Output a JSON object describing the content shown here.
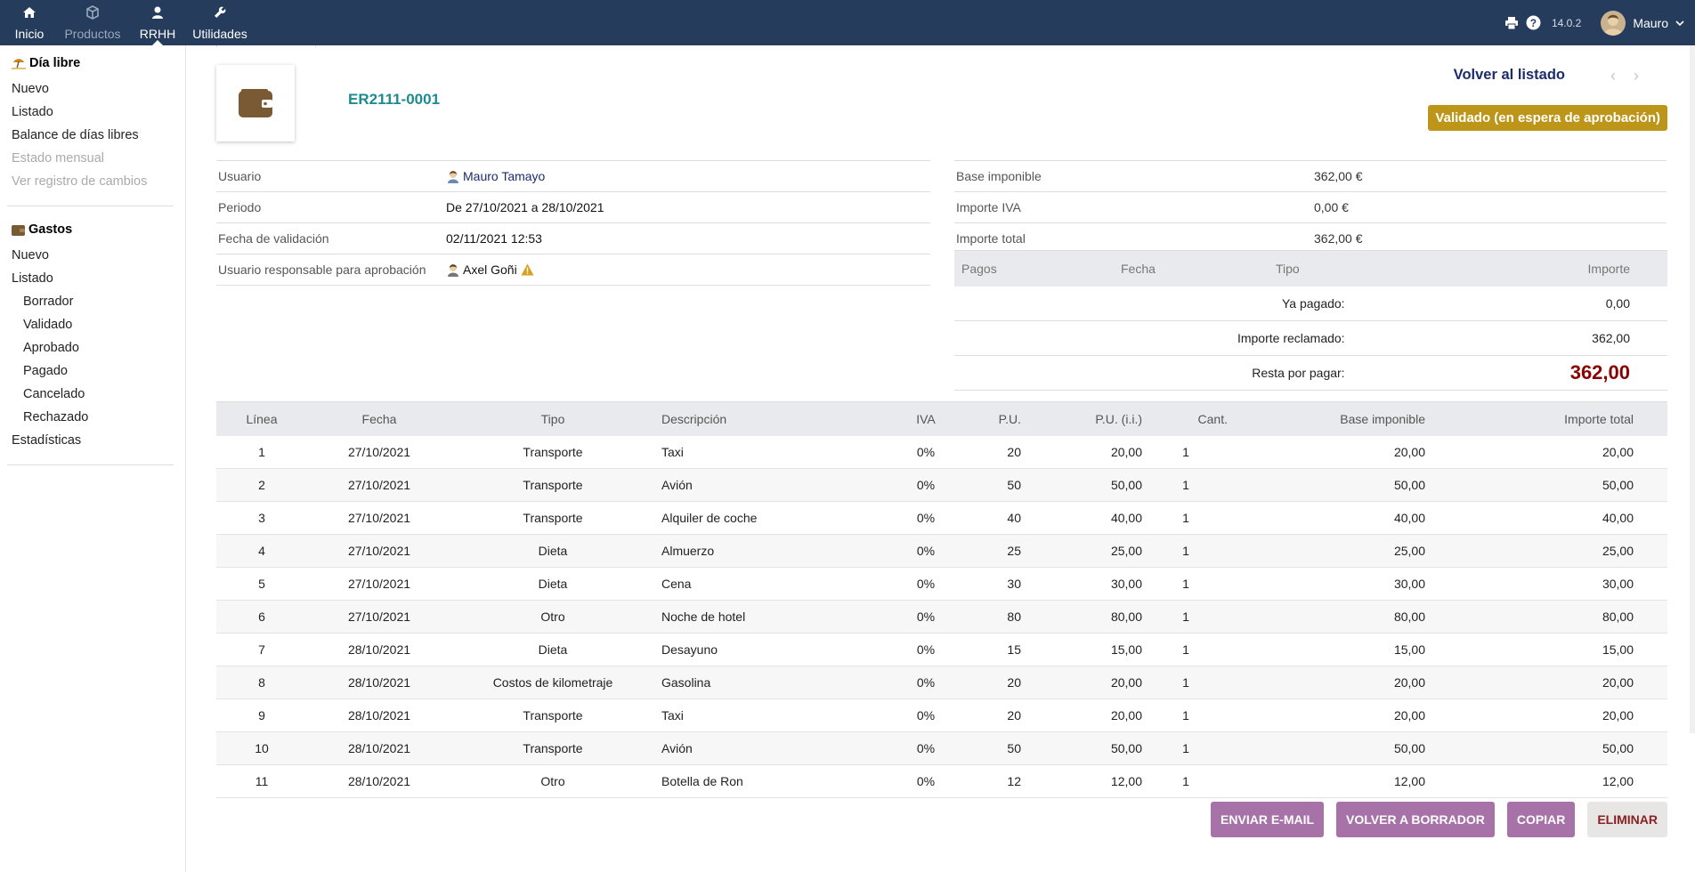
{
  "topbar": {
    "nav": [
      {
        "label": "Inicio",
        "icon": "home-icon",
        "state": "normal"
      },
      {
        "label": "Productos",
        "icon": "cube-icon",
        "state": "dim"
      },
      {
        "label": "RRHH",
        "icon": "user-icon",
        "state": "active"
      },
      {
        "label": "Utilidades",
        "icon": "wrench-icon",
        "state": "normal"
      }
    ],
    "version": "14.0.2",
    "user_name": "Mauro"
  },
  "sidebar": {
    "section1_title": "Día libre",
    "section1_items": [
      "Nuevo",
      "Listado",
      "Balance de días libres",
      "Estado mensual",
      "Ver registro de cambios"
    ],
    "section2_title": "Gastos",
    "section2_items": [
      "Nuevo",
      "Listado",
      "Borrador",
      "Validado",
      "Aprobado",
      "Pagado",
      "Cancelado",
      "Rechazado",
      "Estadísticas"
    ]
  },
  "header": {
    "ref": "ER2111-0001",
    "back_label": "Volver al listado",
    "status": "Validado (en espera de aprobación)"
  },
  "info_left": [
    {
      "label": "Usuario",
      "value": "Mauro Tamayo"
    },
    {
      "label": "Periodo",
      "value": "De 27/10/2021 a 28/10/2021"
    },
    {
      "label": "Fecha de validación",
      "value": "02/11/2021 12:53"
    },
    {
      "label": "Usuario responsable para aprobación",
      "value": "Axel Goñi"
    }
  ],
  "info_right": [
    {
      "label": "Base imponible",
      "value": "362,00 €"
    },
    {
      "label": "Importe IVA",
      "value": "0,00 €"
    },
    {
      "label": "Importe total",
      "value": "362,00 €"
    }
  ],
  "payments": {
    "headers": [
      "Pagos",
      "Fecha",
      "Tipo",
      "Importe"
    ],
    "paid_label": "Ya pagado:",
    "paid_value": "0,00",
    "claimed_label": "Importe reclamado:",
    "claimed_value": "362,00",
    "remain_label": "Resta por pagar:",
    "remain_value": "362,00"
  },
  "lines": {
    "headers": [
      "Línea",
      "Fecha",
      "Tipo",
      "Descripción",
      "IVA",
      "P.U.",
      "P.U. (i.i.)",
      "Cant.",
      "Base imponible",
      "Importe total"
    ],
    "rows": [
      [
        "1",
        "27/10/2021",
        "Transporte",
        "Taxi",
        "0%",
        "20",
        "20,00",
        "1",
        "20,00",
        "20,00"
      ],
      [
        "2",
        "27/10/2021",
        "Transporte",
        "Avión",
        "0%",
        "50",
        "50,00",
        "1",
        "50,00",
        "50,00"
      ],
      [
        "3",
        "27/10/2021",
        "Transporte",
        "Alquiler de coche",
        "0%",
        "40",
        "40,00",
        "1",
        "40,00",
        "40,00"
      ],
      [
        "4",
        "27/10/2021",
        "Dieta",
        "Almuerzo",
        "0%",
        "25",
        "25,00",
        "1",
        "25,00",
        "25,00"
      ],
      [
        "5",
        "27/10/2021",
        "Dieta",
        "Cena",
        "0%",
        "30",
        "30,00",
        "1",
        "30,00",
        "30,00"
      ],
      [
        "6",
        "27/10/2021",
        "Otro",
        "Noche de hotel",
        "0%",
        "80",
        "80,00",
        "1",
        "80,00",
        "80,00"
      ],
      [
        "7",
        "28/10/2021",
        "Dieta",
        "Desayuno",
        "0%",
        "15",
        "15,00",
        "1",
        "15,00",
        "15,00"
      ],
      [
        "8",
        "28/10/2021",
        "Costos de kilometraje",
        "Gasolina",
        "0%",
        "20",
        "20,00",
        "1",
        "20,00",
        "20,00"
      ],
      [
        "9",
        "28/10/2021",
        "Transporte",
        "Taxi",
        "0%",
        "20",
        "20,00",
        "1",
        "20,00",
        "20,00"
      ],
      [
        "10",
        "28/10/2021",
        "Transporte",
        "Avión",
        "0%",
        "50",
        "50,00",
        "1",
        "50,00",
        "50,00"
      ],
      [
        "11",
        "28/10/2021",
        "Otro",
        "Botella de Ron",
        "0%",
        "12",
        "12,00",
        "1",
        "12,00",
        "12,00"
      ]
    ]
  },
  "actions": [
    "ENVIAR E-MAIL",
    "VOLVER A BORRADOR",
    "COPIAR",
    "ELIMINAR"
  ],
  "colors": {
    "topbar": "#263c5c",
    "status": "#bd9519",
    "button": "#a672a8",
    "ref": "#1d8b8f",
    "remain": "#8b0000"
  }
}
